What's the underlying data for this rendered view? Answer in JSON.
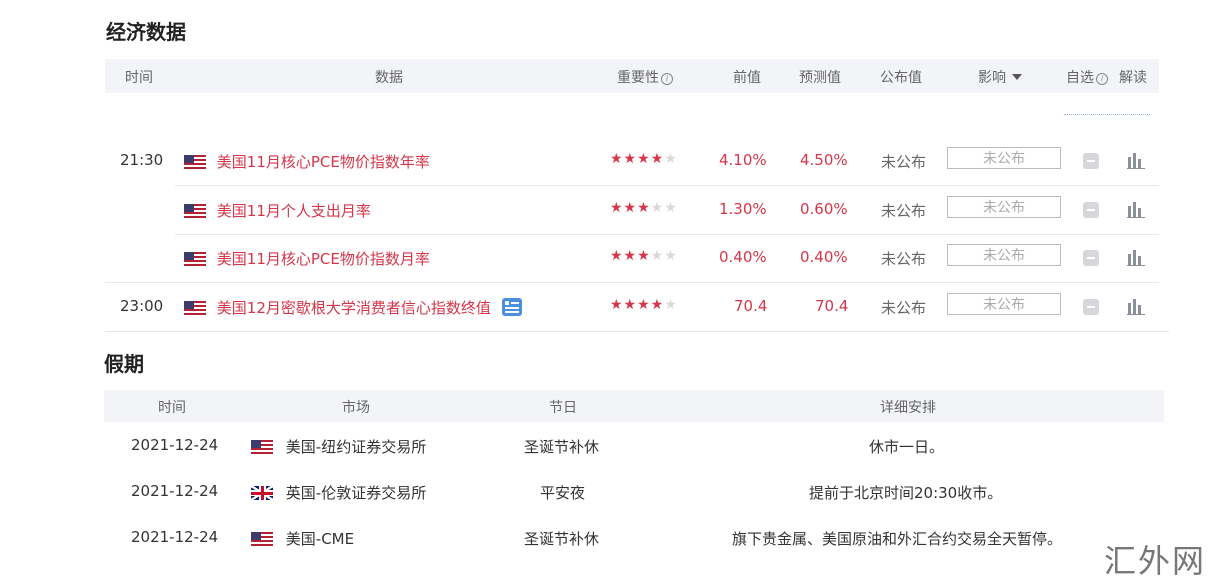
{
  "economic": {
    "title": "经济数据",
    "headers": {
      "time": "时间",
      "data": "数据",
      "importance": "重要性",
      "previous": "前值",
      "forecast": "预测值",
      "actual": "公布值",
      "impact": "影响",
      "watch": "自选",
      "interpret": "解读"
    },
    "rows": [
      {
        "time": "21:30",
        "flag": "us",
        "name": "美国11月核心PCE物价指数年率",
        "stars": 4,
        "previous": "4.10%",
        "forecast": "4.50%",
        "actual": "未公布",
        "impact": "未公布"
      },
      {
        "time": "",
        "flag": "us",
        "name": "美国11月个人支出月率",
        "stars": 3,
        "previous": "1.30%",
        "forecast": "0.60%",
        "actual": "未公布",
        "impact": "未公布"
      },
      {
        "time": "",
        "flag": "us",
        "name": "美国11月核心PCE物价指数月率",
        "stars": 3,
        "previous": "0.40%",
        "forecast": "0.40%",
        "actual": "未公布",
        "impact": "未公布"
      },
      {
        "time": "23:00",
        "flag": "us",
        "name": "美国12月密歇根大学消费者信心指数终值",
        "stars": 4,
        "previous": "70.4",
        "forecast": "70.4",
        "actual": "未公布",
        "impact": "未公布",
        "has_calendar_icon": true
      }
    ]
  },
  "holidays": {
    "title": "假期",
    "headers": {
      "time": "时间",
      "market": "市场",
      "holiday": "节日",
      "details": "详细安排"
    },
    "rows": [
      {
        "date": "2021-12-24",
        "flag": "us",
        "market": "美国-纽约证券交易所",
        "holiday": "圣诞节补休",
        "details": "休市一日。"
      },
      {
        "date": "2021-12-24",
        "flag": "uk",
        "market": "英国-伦敦证券交易所",
        "holiday": "平安夜",
        "details": "提前于北京时间20:30收市。"
      },
      {
        "date": "2021-12-24",
        "flag": "us",
        "market": "美国-CME",
        "holiday": "圣诞节补休",
        "details": "旗下贵金属、美国原油和外汇合约交易全天暂停。"
      }
    ]
  },
  "watermark_text": "汇外网",
  "colors": {
    "accent_red": "#d6354a",
    "header_bg": "#f2f4f8"
  }
}
